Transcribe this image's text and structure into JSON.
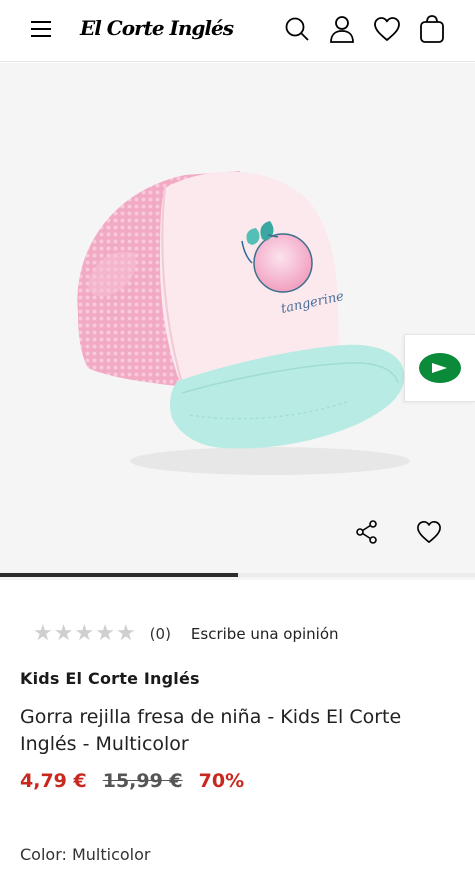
{
  "header": {
    "logo_text": "El Corte Inglés",
    "icons": [
      "menu-icon",
      "search-icon",
      "user-icon",
      "heart-icon",
      "bag-icon"
    ]
  },
  "gallery": {
    "cap_print_text": "tangerine",
    "actions": [
      "share-icon",
      "heart-icon"
    ],
    "carousel_progress": 0.5
  },
  "product": {
    "rating": {
      "stars_filled": 0,
      "stars_total": 5,
      "count": "(0)",
      "write_review": "Escribe una opinión"
    },
    "brand": "Kids El Corte Inglés",
    "title": "Gorra rejilla fresa de niña - Kids El Corte Inglés - Multicolor",
    "price_current": "4,79 €",
    "price_original": "15,99 €",
    "discount": "70%",
    "color_label": "Color: Multicolor"
  },
  "colors": {
    "price_red": "#c8281e",
    "brand_green": "#0b8a3a"
  }
}
